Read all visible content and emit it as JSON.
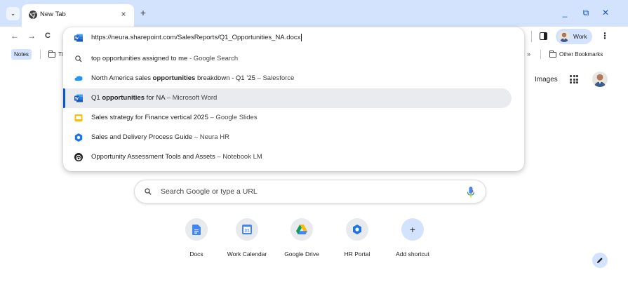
{
  "tabstrip": {
    "tab_title": "New Tab",
    "new_tab_symbol": "+",
    "close_symbol": "×",
    "tab_search_symbol": "⌄",
    "minimize_symbol": "_",
    "restore_symbol": "⧉",
    "close_window_symbol": "✕"
  },
  "toolbar": {
    "back_symbol": "←",
    "forward_symbol": "→",
    "reload_symbol": "C",
    "profile_label": "Work",
    "menu_symbol": "⋮"
  },
  "bookmarks": {
    "notes_label": "Notes",
    "folder_truncated_label": "Ti",
    "overflow_symbol": "»",
    "other_bookmarks_label": "Other Bookmarks"
  },
  "omnibox": {
    "input_value": "https://neura.sharepoint.com/SalesReports/Q1_Opportunities_NA.docx",
    "suggestions": [
      {
        "icon": "search-icon",
        "prefix": "",
        "match": "",
        "suffix": "top opportunities assigned to me",
        "source": " - Google Search"
      },
      {
        "icon": "salesforce-icon",
        "prefix": "North America sales ",
        "match": "opportunities",
        "suffix": " breakdown - Q1 ’25",
        "source": " – Salesforce"
      },
      {
        "icon": "word-icon",
        "prefix": "Q1 ",
        "match": "opportunities",
        "suffix": " for NA",
        "source": " – Microsoft Word"
      },
      {
        "icon": "slides-icon",
        "prefix": "",
        "match": "",
        "suffix": "Sales strategy for Finance vertical 2025",
        "source": " – Google Slides"
      },
      {
        "icon": "hr-icon",
        "prefix": "",
        "match": "",
        "suffix": "Sales and Delivery Process Guide",
        "source": " – Neura HR"
      },
      {
        "icon": "notebooklm-icon",
        "prefix": "",
        "match": "",
        "suffix": "Opportunity Assessment Tools and Assets",
        "source": " – Notebook LM"
      }
    ],
    "selected_index": 2
  },
  "ntp": {
    "images_label": "Images",
    "search_placeholder": "Search Google or type a URL",
    "shortcuts": [
      {
        "label": "Docs",
        "icon": "docs-icon"
      },
      {
        "label": "Work Calendar",
        "icon": "calendar-icon"
      },
      {
        "label": "Google Drive",
        "icon": "drive-icon"
      },
      {
        "label": "HR Portal",
        "icon": "hr-portal-icon"
      },
      {
        "label": "Add shortcut",
        "icon": "plus-icon"
      }
    ],
    "calendar_day": "31",
    "add_symbol": "+"
  },
  "colors": {
    "tabstrip_bg": "#d3e3fd",
    "accent": "#0b57d0",
    "window_controls": "#1a56c9"
  }
}
